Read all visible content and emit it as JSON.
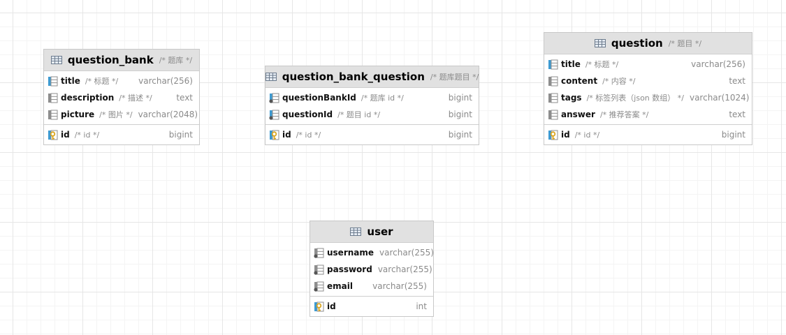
{
  "tables": [
    {
      "name": "question_bank",
      "comment": "/* 题库 */",
      "columns": [
        {
          "name": "title",
          "comment": "/* 标题 */",
          "type": "varchar(256)",
          "kind": "required"
        },
        {
          "name": "description",
          "comment": "/* 描述 */",
          "type": "text",
          "kind": "normal"
        },
        {
          "name": "picture",
          "comment": "/* 图片 */",
          "type": "varchar(2048)",
          "kind": "normal"
        }
      ],
      "pk": {
        "name": "id",
        "comment": "/* id */",
        "type": "bigint"
      }
    },
    {
      "name": "question_bank_question",
      "comment": "/* 题库题目 */",
      "columns": [
        {
          "name": "questionBankId",
          "comment": "/* 题库 id */",
          "type": "bigint",
          "kind": "fk"
        },
        {
          "name": "questionId",
          "comment": "/* 题目 id */",
          "type": "bigint",
          "kind": "fk"
        }
      ],
      "pk": {
        "name": "id",
        "comment": "/* id */",
        "type": "bigint"
      }
    },
    {
      "name": "question",
      "comment": "/* 题目 */",
      "columns": [
        {
          "name": "title",
          "comment": "/* 标题 */",
          "type": "varchar(256)",
          "kind": "required"
        },
        {
          "name": "content",
          "comment": "/* 内容 */",
          "type": "text",
          "kind": "normal"
        },
        {
          "name": "tags",
          "comment": "/* 标签列表（json 数组） */",
          "type": "varchar(1024)",
          "kind": "normal"
        },
        {
          "name": "answer",
          "comment": "/* 推荐答案 */",
          "type": "text",
          "kind": "normal"
        }
      ],
      "pk": {
        "name": "id",
        "comment": "/* id */",
        "type": "bigint"
      }
    },
    {
      "name": "user",
      "comment": "",
      "columns": [
        {
          "name": "username",
          "comment": "",
          "type": "varchar(255)",
          "kind": "fk"
        },
        {
          "name": "password",
          "comment": "",
          "type": "varchar(255)",
          "kind": "fk"
        },
        {
          "name": "email",
          "comment": "",
          "type": "varchar(255)",
          "kind": "fk"
        }
      ],
      "pk": {
        "name": "id",
        "comment": "",
        "type": "int"
      }
    }
  ],
  "icons": {
    "table": "table-icon",
    "required": "column-required-icon",
    "normal": "column-icon",
    "fk": "column-index-icon",
    "pk": "primary-key-icon"
  },
  "colors": {
    "header_bg": "#e1e1e1",
    "grid": "#e6e6e6",
    "key_gold": "#d9a520",
    "column_blue": "#3d9ad1",
    "muted_text": "#8a8a8a"
  }
}
